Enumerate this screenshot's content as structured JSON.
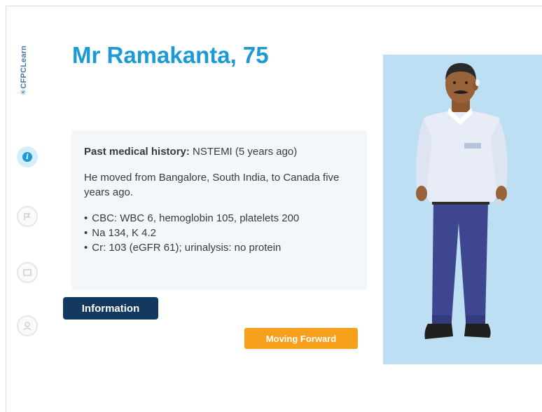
{
  "brand": {
    "logo_text": "✳CFPCLearn"
  },
  "sidebar": {
    "items": [
      {
        "name": "information",
        "icon": "info-icon",
        "active": true
      },
      {
        "name": "flag",
        "icon": "flag-icon",
        "active": false
      },
      {
        "name": "card",
        "icon": "card-icon",
        "active": false
      },
      {
        "name": "profile",
        "icon": "person-icon",
        "active": false
      }
    ]
  },
  "patient": {
    "title": "Mr Ramakanta, 75"
  },
  "info_card": {
    "history_label": "Past medical history:",
    "history_value": " NSTEMI (5 years ago)",
    "background": "He moved from Bangalore, South India, to Canada five years ago.",
    "labs": [
      "CBC: WBC 6, hemoglobin 105, platelets 200",
      "Na 134, K 4.2",
      "Cr: 103 (eGFR 61); urinalysis: no protein"
    ]
  },
  "tag": {
    "label": "Information"
  },
  "actions": {
    "next_label": "Moving Forward"
  },
  "colors": {
    "accent": "#1b9ad6",
    "tag_bg": "#14395e",
    "button_bg": "#f7a01c",
    "panel_bg": "#bcdff3",
    "card_bg": "#f3f7fa"
  }
}
